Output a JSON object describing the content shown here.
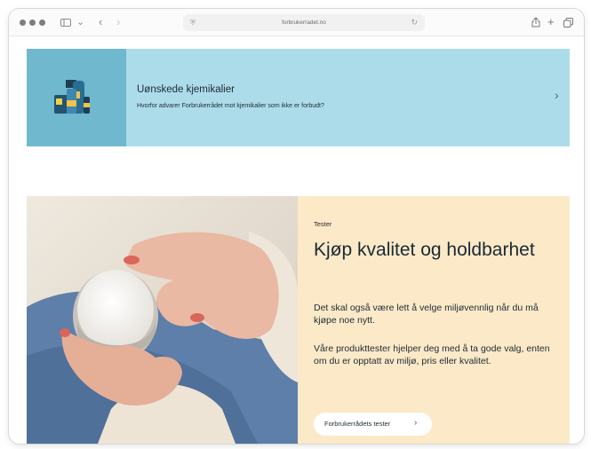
{
  "browser": {
    "url": "forbrukerradet.no",
    "icons": [
      "window-dot-icon",
      "sidebar-icon",
      "chevron-down-icon",
      "back-icon",
      "forward-icon",
      "shield-icon",
      "reload-icon",
      "share-icon",
      "new-tab-icon",
      "tabs-overview-icon"
    ]
  },
  "banner": {
    "title": "Uønskede kjemikalier",
    "subtitle": "Hvorfor advarer Forbrukerrådet mot kjemikalier som ikke er forbudt?",
    "colors": {
      "background": "#acdcea",
      "image_background": "#6fb8cd"
    }
  },
  "hero": {
    "eyebrow": "Tester",
    "heading": "Kjøp kvalitet og holdbarhet",
    "paragraph1": "Det skal også være lett å velge miljøvennlig når du må kjøpe noe nytt.",
    "paragraph2": "Våre produkttester hjelper deg med å ta gode valg, enten om du er opptatt av miljø, pris eller kvalitet.",
    "cta_label": "Forbrukerrådets tester",
    "colors": {
      "panel_background": "#fbe9c8"
    }
  }
}
